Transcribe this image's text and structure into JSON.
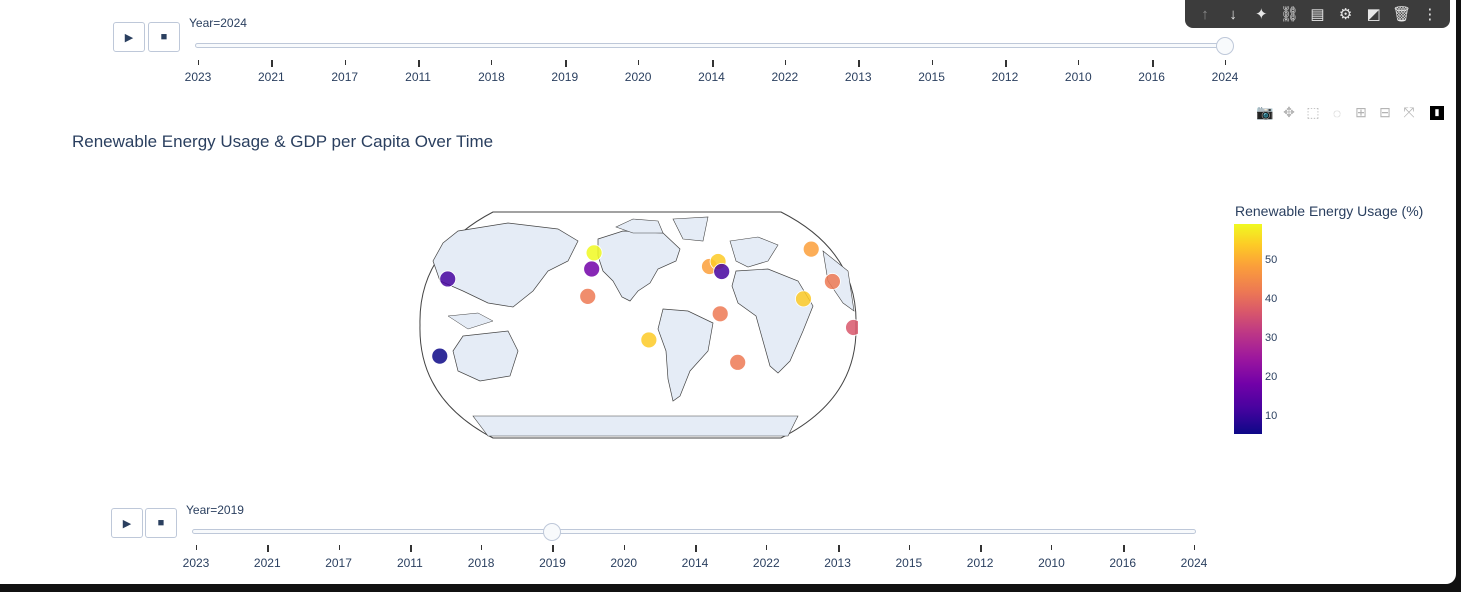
{
  "cell_toolbar": {
    "icons": [
      "arrow-up-icon",
      "arrow-down-icon",
      "sparkle-icon",
      "link-icon",
      "comment-icon",
      "gear-icon",
      "split-icon",
      "trash-icon",
      "more-vertical-icon"
    ]
  },
  "top_slider": {
    "current_label": "Year=2024",
    "play": "▶",
    "stop": "■",
    "steps": [
      "2023",
      "2021",
      "2017",
      "2011",
      "2018",
      "2019",
      "2020",
      "2014",
      "2022",
      "2013",
      "2015",
      "2012",
      "2010",
      "2016",
      "2024"
    ],
    "active_index": 14
  },
  "bottom_slider": {
    "current_label": "Year=2019",
    "play": "▶",
    "stop": "■",
    "steps": [
      "2023",
      "2021",
      "2017",
      "2011",
      "2018",
      "2019",
      "2020",
      "2014",
      "2022",
      "2013",
      "2015",
      "2012",
      "2010",
      "2016",
      "2024"
    ],
    "active_index": 5
  },
  "modebar": {
    "icons": [
      "camera-icon",
      "pan-icon",
      "box-select-icon",
      "lasso-icon",
      "zoom-in-icon",
      "zoom-out-icon",
      "autoscale-icon",
      "plotly-logo-icon"
    ]
  },
  "chart_data": {
    "type": "scatter",
    "title": "Renewable Energy Usage & GDP per Capita Over Time",
    "projection": "natural earth",
    "colorbar": {
      "title": "Renewable Energy Usage (%)",
      "ticks": [
        "50",
        "40",
        "30",
        "20",
        "10"
      ],
      "range": [
        5,
        60
      ],
      "colorscale": "plasma"
    },
    "points": [
      {
        "lon": -100,
        "lat": 45,
        "renewable": 20
      },
      {
        "lon": -99,
        "lat": 58,
        "renewable": 58
      },
      {
        "lon": -102,
        "lat": 23,
        "renewable": 42
      },
      {
        "lon": -51,
        "lat": -12,
        "renewable": 56
      },
      {
        "lon": 2,
        "lat": 47,
        "renewable": 50
      },
      {
        "lon": 10,
        "lat": 51,
        "renewable": 55
      },
      {
        "lon": 12,
        "lat": 43,
        "renewable": 10
      },
      {
        "lon": 8,
        "lat": 9,
        "renewable": 40
      },
      {
        "lon": 24,
        "lat": -30,
        "renewable": 40
      },
      {
        "lon": 78,
        "lat": 21,
        "renewable": 55
      },
      {
        "lon": 105,
        "lat": 35,
        "renewable": 40
      },
      {
        "lon": 95,
        "lat": 61,
        "renewable": 45
      },
      {
        "lon": 138,
        "lat": 37,
        "renewable": 10
      },
      {
        "lon": 118,
        "lat": -2,
        "renewable": 35
      },
      {
        "lon": 134,
        "lat": -25,
        "renewable": 8
      }
    ]
  }
}
